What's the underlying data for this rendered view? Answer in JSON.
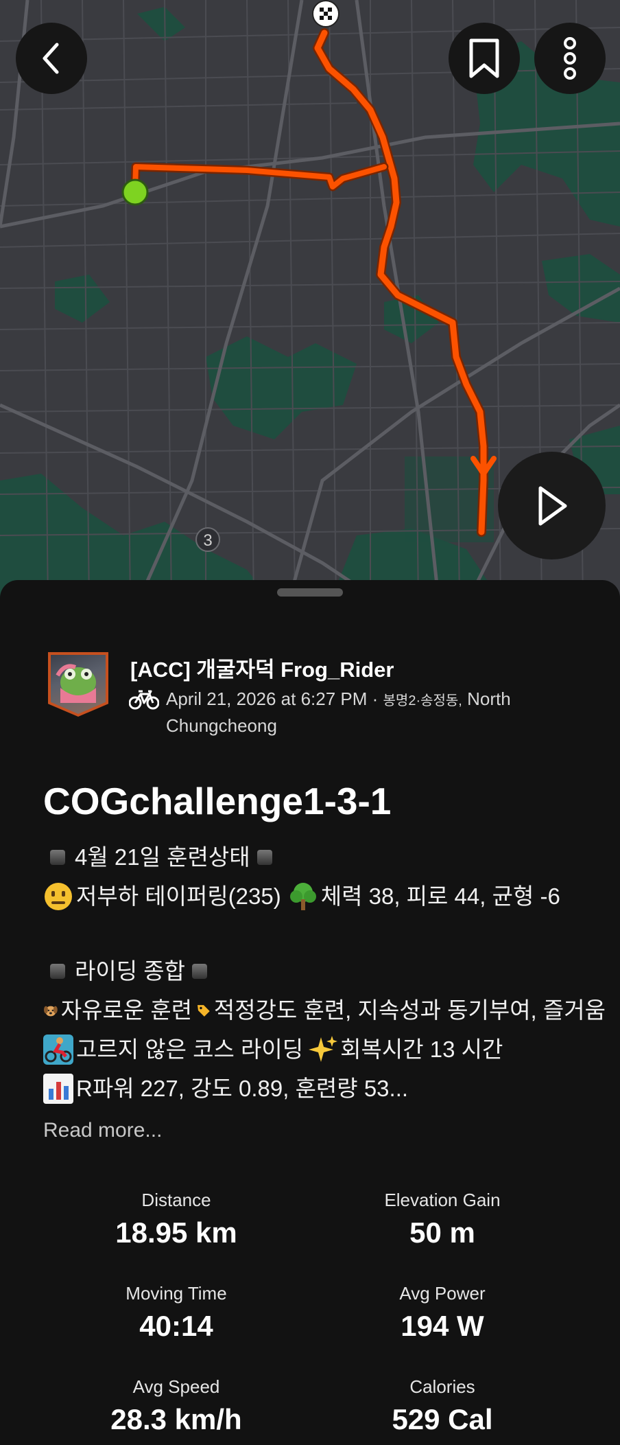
{
  "map": {
    "colors": {
      "background": "#3a3b40",
      "roads": "#55565c",
      "parks": "#1f4d3f",
      "route": "#fc5200",
      "start_marker": "#7ed321"
    },
    "highway_shield": "3"
  },
  "header": {
    "back_icon": "chevron-left-icon",
    "bookmark_icon": "bookmark-icon",
    "more_icon": "vertical-dots-icon"
  },
  "play_icon": "play-icon",
  "athlete": {
    "name": "[ACC] 개굴자덕 Frog_Rider",
    "activity_icon": "bike-icon",
    "date": "April 21, 2026 at 6:27 PM",
    "separator": " · ",
    "location_kr": "봉명2·송정동,",
    "location_en": " North Chungcheong"
  },
  "activity": {
    "title": "COGchallenge1-3-1",
    "description": {
      "line1": "4월 21일 훈련상태",
      "line2_a": "저부하 테이퍼링(235)",
      "line2_b": "체력 38, 피로 44, 균형 -6",
      "line3": "라이딩 종합",
      "line4_a": "자유로운 훈련",
      "line4_b": "적정강도 훈련, 지속성과 동기부여, 즐거움",
      "line5_a": "고르지 않은 코스 라이딩",
      "line5_b": "회복시간 13 시간",
      "line6": "R파워 227, 강도 0.89, 훈련량 53..."
    },
    "read_more": "Read more..."
  },
  "stats": {
    "distance": {
      "label": "Distance",
      "value": "18.95 km"
    },
    "elevation": {
      "label": "Elevation Gain",
      "value": "50 m"
    },
    "moving_time": {
      "label": "Moving Time",
      "value": "40:14"
    },
    "avg_power": {
      "label": "Avg Power",
      "value": "194 W"
    },
    "avg_speed": {
      "label": "Avg Speed",
      "value": "28.3 km/h"
    },
    "calories": {
      "label": "Calories",
      "value": "529 Cal"
    }
  }
}
